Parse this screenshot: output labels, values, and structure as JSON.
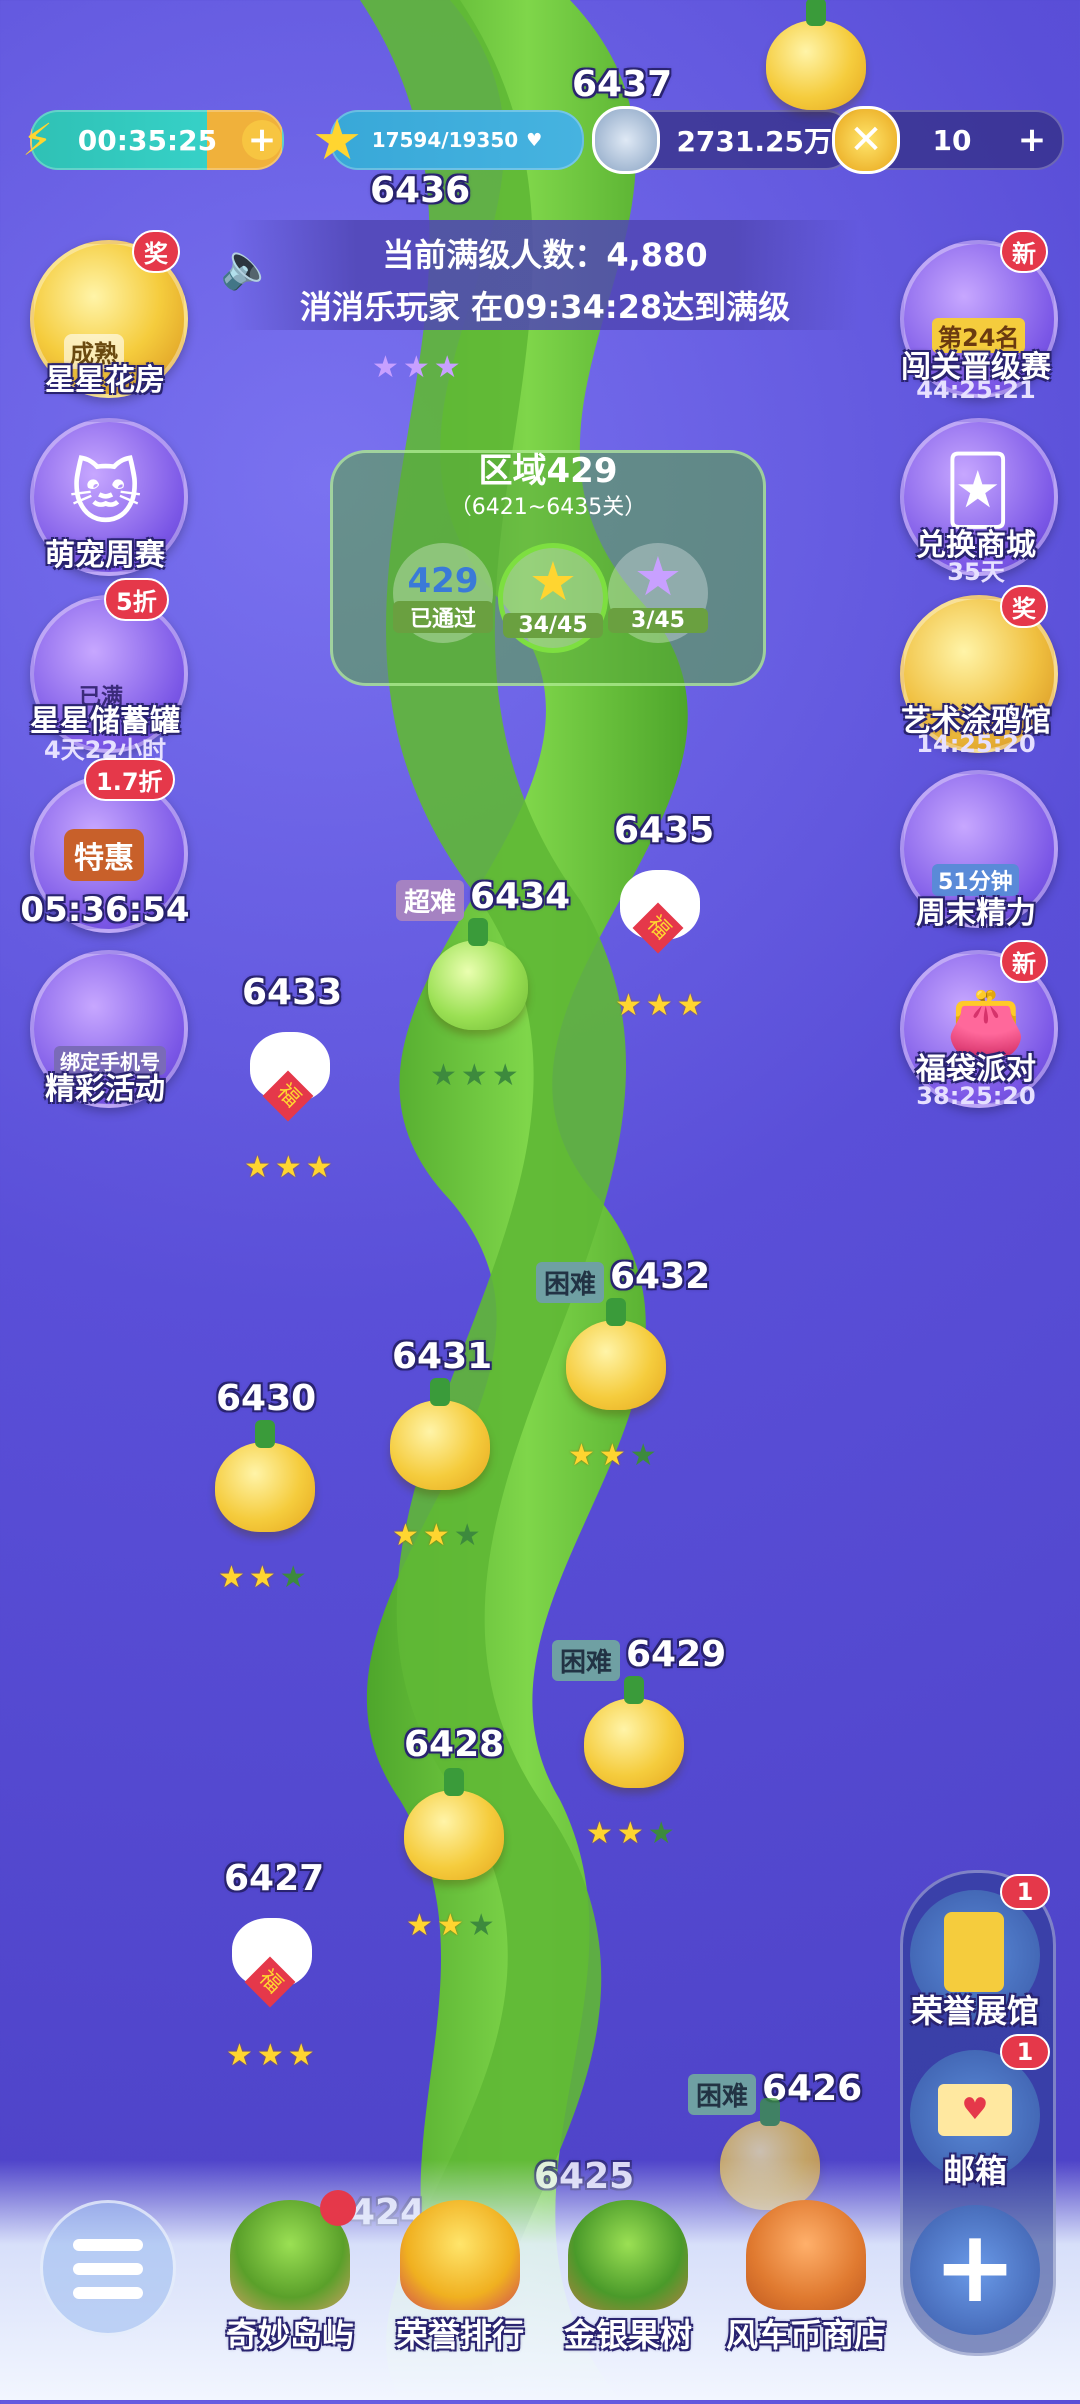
{
  "top": {
    "timer": "00:35:25",
    "stars_progress": "17594/19350",
    "coins": "2731.25万",
    "gold": "10"
  },
  "banner": {
    "line1": "当前满级人数：4,880",
    "line2": "消消乐玩家 在09:34:28达到满级"
  },
  "region": {
    "title": "区域429",
    "range": "（6421~6435关）",
    "passed_num": "429",
    "passed_label": "已通过",
    "stars": "34/45",
    "rainbow": "3/45"
  },
  "left_icons": [
    {
      "label": "星星花房",
      "badge": "奖",
      "sub": "成熟"
    },
    {
      "label": "萌宠周赛"
    },
    {
      "label": "星星储蓄罐",
      "badge": "5折",
      "sub": "已满",
      "timer": "4天22小时"
    },
    {
      "label": "05:36:54",
      "badge": "1.7折",
      "sub": "特惠"
    },
    {
      "label": "精彩活动",
      "sub": "绑定手机号"
    }
  ],
  "right_icons": [
    {
      "label": "闯关晋级赛",
      "badge": "新",
      "sub": "第24名",
      "timer": "44:25:21"
    },
    {
      "label": "兑换商城",
      "timer": "35天"
    },
    {
      "label": "艺术涂鸦馆",
      "badge": "奖",
      "timer": "14:25:20"
    },
    {
      "label": "周末精力",
      "sub": "51分钟"
    },
    {
      "label": "福袋派对",
      "badge": "新",
      "timer": "38:25:20"
    }
  ],
  "levels": {
    "l6437": "6437",
    "l6436": "6436",
    "l6435": "6435",
    "l6434": "6434",
    "l6433": "6433",
    "l6432": "6432",
    "l6431": "6431",
    "l6430": "6430",
    "l6429": "6429",
    "l6428": "6428",
    "l6427": "6427",
    "l6426": "6426",
    "l6425": "6425",
    "l6424": "424"
  },
  "tags": {
    "super": "超难",
    "hard": "困难"
  },
  "bunny_char": "福",
  "panel": {
    "honor": "荣誉展馆",
    "honor_badge": "1",
    "mail": "邮箱",
    "mail_badge": "1"
  },
  "nav": {
    "island": "奇妙岛屿",
    "rank": "荣誉排行",
    "tree": "金银果树",
    "shop": "风车币商店"
  },
  "colors": {
    "background": "#5a4fd8",
    "vine": "#6ac33a",
    "fruit": "#f5cc3d",
    "star_on": "#ffd530"
  }
}
